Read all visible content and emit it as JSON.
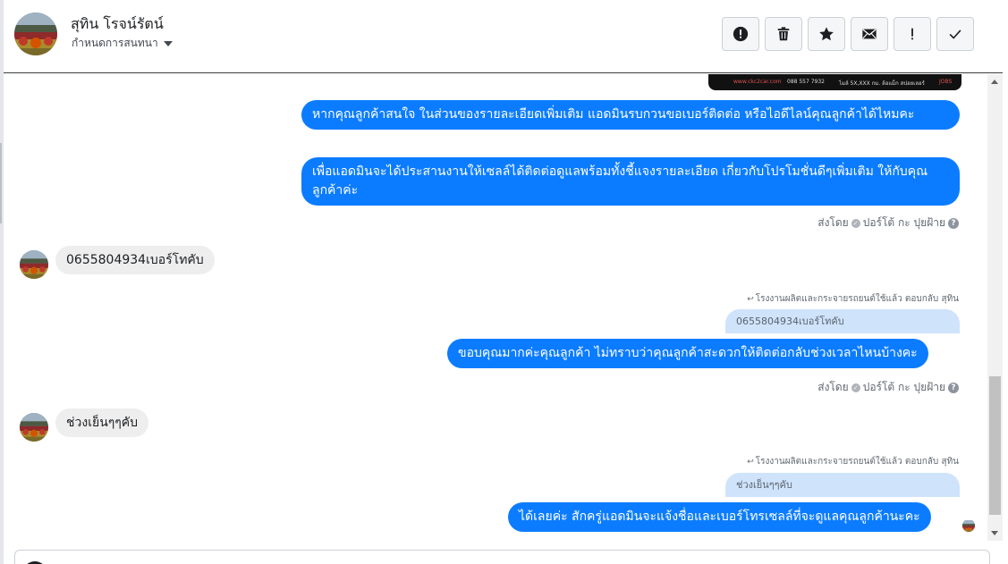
{
  "header": {
    "name": "สุทิน โรจน์รัตน์",
    "assign_label": "กำหนดการสนทนา"
  },
  "toolbar": [
    {
      "name": "report-icon",
      "glyph": "!"
    },
    {
      "name": "trash-icon",
      "glyph": "trash"
    },
    {
      "name": "star-icon",
      "glyph": "star"
    },
    {
      "name": "mail-icon",
      "glyph": "mail"
    },
    {
      "name": "exclamation-icon",
      "glyph": "!"
    },
    {
      "name": "checkmark-icon",
      "glyph": "check"
    }
  ],
  "promo_image": {
    "line1": "...",
    "url": "www.ckc2car.com",
    "phone": "088 557 7932",
    "mileage": "ไมล์ 5X,XXX กม. ล้อแม็ก สปอยเลอร์",
    "tail": "JOBS"
  },
  "messages": {
    "out1": "หากคุณลูกค้าสนใจ ในส่วนของรายละเอียดเพิ่มเติม แอดมินรบกวนขอเบอร์ติดต่อ หรือไอดีไลน์คุณลูกค้าได้ไหมคะ",
    "out2": "เพื่อแอดมินจะได้ประสานงานให้เซลล์ได้ติดต่อดูแลพร้อมทั้งชี้แจงรายละเอียด เกี่ยวกับโปรโมชั่นดีๆเพิ่มเติม ให้กับคุณลูกค้าค่ะ",
    "sent_by_1": {
      "prefix": "ส่งโดย",
      "agent": "ปอร์โต้ กะ ปุยฝ้าย"
    },
    "in1": "0655804934เบอร์โทคับ",
    "reply_note_1": "โรงงานผลิตและกระจายรถยนต์ใช้แล้ว ตอบกลับ สุทิน",
    "quote1": "0655804934เบอร์โทคับ",
    "out3": "ขอบคุณมากค่ะคุณลูกค้า ไม่ทราบว่าคุณลูกค้าสะดวกให้ติดต่อกลับช่วงเวลาไหนบ้างคะ",
    "sent_by_2": {
      "prefix": "ส่งโดย",
      "agent": "ปอร์โต้ กะ ปุยฝ้าย"
    },
    "in2": "ช่วงเย็นๆๆคับ",
    "reply_note_2": "โรงงานผลิตและกระจายรถยนต์ใช้แล้ว ตอบกลับ สุทิน",
    "quote2": "ช่วงเย็นๆๆคับ",
    "out4": "ได้เลยค่ะ สักครู่แอดมินจะแจ้งชื่อและเบอร์โทรเซลล์ที่จะดูแลคุณลูกค้านะคะ"
  },
  "colors": {
    "outgoing_bubble": "#0b7cff",
    "incoming_bubble": "#eeeeee",
    "quote_bubble": "#cfe3fb"
  }
}
